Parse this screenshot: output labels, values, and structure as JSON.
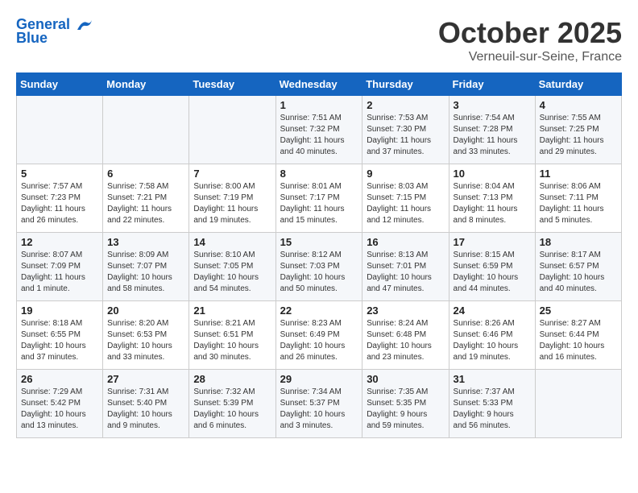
{
  "header": {
    "logo_line1": "General",
    "logo_line2": "Blue",
    "month_title": "October 2025",
    "location": "Verneuil-sur-Seine, France"
  },
  "weekdays": [
    "Sunday",
    "Monday",
    "Tuesday",
    "Wednesday",
    "Thursday",
    "Friday",
    "Saturday"
  ],
  "weeks": [
    [
      {
        "day": "",
        "info": ""
      },
      {
        "day": "",
        "info": ""
      },
      {
        "day": "",
        "info": ""
      },
      {
        "day": "1",
        "info": "Sunrise: 7:51 AM\nSunset: 7:32 PM\nDaylight: 11 hours\nand 40 minutes."
      },
      {
        "day": "2",
        "info": "Sunrise: 7:53 AM\nSunset: 7:30 PM\nDaylight: 11 hours\nand 37 minutes."
      },
      {
        "day": "3",
        "info": "Sunrise: 7:54 AM\nSunset: 7:28 PM\nDaylight: 11 hours\nand 33 minutes."
      },
      {
        "day": "4",
        "info": "Sunrise: 7:55 AM\nSunset: 7:25 PM\nDaylight: 11 hours\nand 29 minutes."
      }
    ],
    [
      {
        "day": "5",
        "info": "Sunrise: 7:57 AM\nSunset: 7:23 PM\nDaylight: 11 hours\nand 26 minutes."
      },
      {
        "day": "6",
        "info": "Sunrise: 7:58 AM\nSunset: 7:21 PM\nDaylight: 11 hours\nand 22 minutes."
      },
      {
        "day": "7",
        "info": "Sunrise: 8:00 AM\nSunset: 7:19 PM\nDaylight: 11 hours\nand 19 minutes."
      },
      {
        "day": "8",
        "info": "Sunrise: 8:01 AM\nSunset: 7:17 PM\nDaylight: 11 hours\nand 15 minutes."
      },
      {
        "day": "9",
        "info": "Sunrise: 8:03 AM\nSunset: 7:15 PM\nDaylight: 11 hours\nand 12 minutes."
      },
      {
        "day": "10",
        "info": "Sunrise: 8:04 AM\nSunset: 7:13 PM\nDaylight: 11 hours\nand 8 minutes."
      },
      {
        "day": "11",
        "info": "Sunrise: 8:06 AM\nSunset: 7:11 PM\nDaylight: 11 hours\nand 5 minutes."
      }
    ],
    [
      {
        "day": "12",
        "info": "Sunrise: 8:07 AM\nSunset: 7:09 PM\nDaylight: 11 hours\nand 1 minute."
      },
      {
        "day": "13",
        "info": "Sunrise: 8:09 AM\nSunset: 7:07 PM\nDaylight: 10 hours\nand 58 minutes."
      },
      {
        "day": "14",
        "info": "Sunrise: 8:10 AM\nSunset: 7:05 PM\nDaylight: 10 hours\nand 54 minutes."
      },
      {
        "day": "15",
        "info": "Sunrise: 8:12 AM\nSunset: 7:03 PM\nDaylight: 10 hours\nand 50 minutes."
      },
      {
        "day": "16",
        "info": "Sunrise: 8:13 AM\nSunset: 7:01 PM\nDaylight: 10 hours\nand 47 minutes."
      },
      {
        "day": "17",
        "info": "Sunrise: 8:15 AM\nSunset: 6:59 PM\nDaylight: 10 hours\nand 44 minutes."
      },
      {
        "day": "18",
        "info": "Sunrise: 8:17 AM\nSunset: 6:57 PM\nDaylight: 10 hours\nand 40 minutes."
      }
    ],
    [
      {
        "day": "19",
        "info": "Sunrise: 8:18 AM\nSunset: 6:55 PM\nDaylight: 10 hours\nand 37 minutes."
      },
      {
        "day": "20",
        "info": "Sunrise: 8:20 AM\nSunset: 6:53 PM\nDaylight: 10 hours\nand 33 minutes."
      },
      {
        "day": "21",
        "info": "Sunrise: 8:21 AM\nSunset: 6:51 PM\nDaylight: 10 hours\nand 30 minutes."
      },
      {
        "day": "22",
        "info": "Sunrise: 8:23 AM\nSunset: 6:49 PM\nDaylight: 10 hours\nand 26 minutes."
      },
      {
        "day": "23",
        "info": "Sunrise: 8:24 AM\nSunset: 6:48 PM\nDaylight: 10 hours\nand 23 minutes."
      },
      {
        "day": "24",
        "info": "Sunrise: 8:26 AM\nSunset: 6:46 PM\nDaylight: 10 hours\nand 19 minutes."
      },
      {
        "day": "25",
        "info": "Sunrise: 8:27 AM\nSunset: 6:44 PM\nDaylight: 10 hours\nand 16 minutes."
      }
    ],
    [
      {
        "day": "26",
        "info": "Sunrise: 7:29 AM\nSunset: 5:42 PM\nDaylight: 10 hours\nand 13 minutes."
      },
      {
        "day": "27",
        "info": "Sunrise: 7:31 AM\nSunset: 5:40 PM\nDaylight: 10 hours\nand 9 minutes."
      },
      {
        "day": "28",
        "info": "Sunrise: 7:32 AM\nSunset: 5:39 PM\nDaylight: 10 hours\nand 6 minutes."
      },
      {
        "day": "29",
        "info": "Sunrise: 7:34 AM\nSunset: 5:37 PM\nDaylight: 10 hours\nand 3 minutes."
      },
      {
        "day": "30",
        "info": "Sunrise: 7:35 AM\nSunset: 5:35 PM\nDaylight: 9 hours\nand 59 minutes."
      },
      {
        "day": "31",
        "info": "Sunrise: 7:37 AM\nSunset: 5:33 PM\nDaylight: 9 hours\nand 56 minutes."
      },
      {
        "day": "",
        "info": ""
      }
    ]
  ]
}
